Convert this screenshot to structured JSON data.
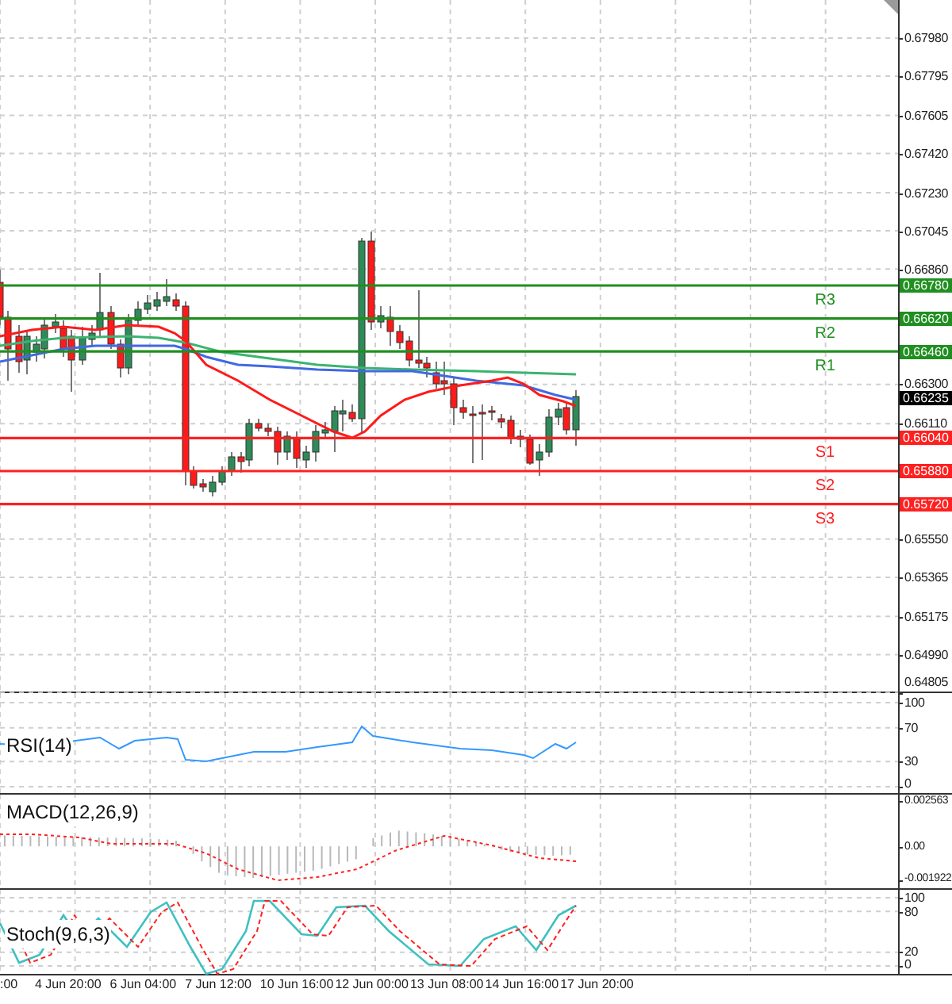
{
  "price_axis": {
    "labels": [
      "0.67980",
      "0.67795",
      "0.67605",
      "0.67420",
      "0.67230",
      "0.67045",
      "0.66860",
      "0.66300",
      "0.66110",
      "0.65550",
      "0.65365",
      "0.65175",
      "0.64990",
      "0.64805"
    ]
  },
  "current_price": {
    "label": "0.66235"
  },
  "levels": [
    {
      "name": "R3",
      "value": "0.66780",
      "color": "#1f8f1f"
    },
    {
      "name": "R2",
      "value": "0.66620",
      "color": "#1f8f1f"
    },
    {
      "name": "R1",
      "value": "0.66460",
      "color": "#1f8f1f"
    },
    {
      "name": "S1",
      "value": "0.66040",
      "color": "#ff2020"
    },
    {
      "name": "S2",
      "value": "0.65880",
      "color": "#ff2020"
    },
    {
      "name": "S3",
      "value": "0.65720",
      "color": "#ff2020"
    }
  ],
  "panels": [
    {
      "kind": "rsi",
      "title": "RSI(14)",
      "axis_labels": [
        "100",
        "70",
        "30",
        "0"
      ]
    },
    {
      "kind": "macd",
      "title": "MACD(12,26,9)",
      "axis_labels": [
        "0.002563",
        "0.00",
        "-0.001922"
      ]
    },
    {
      "kind": "stoch",
      "title": "Stoch(9,6,3)",
      "axis_labels": [
        "100",
        "80",
        "20",
        "0"
      ]
    }
  ],
  "time_axis": {
    "labels": [
      ":00",
      "4 Jun 20:00",
      "6 Jun 04:00",
      "7 Jun 12:00",
      "10 Jun 16:00",
      "12 Jun 00:00",
      "13 Jun 08:00",
      "14 Jun 16:00",
      "17 Jun 20:00"
    ]
  }
}
